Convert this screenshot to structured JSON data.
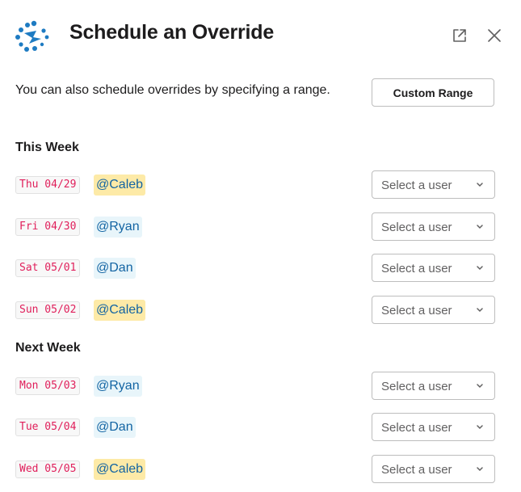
{
  "header": {
    "title": "Schedule an Override",
    "logo": "scheduler-app-logo",
    "external_link_icon": "external-link-icon",
    "close_icon": "close-icon"
  },
  "intro": {
    "text": "You can also schedule overrides by specifying a range.",
    "button_label": "Custom Range"
  },
  "sections": [
    {
      "title": "This Week",
      "rows": [
        {
          "date": "Thu 04/29",
          "user": "@Caleb",
          "highlight": "self",
          "select_placeholder": "Select a user"
        },
        {
          "date": "Fri 04/30",
          "user": "@Ryan",
          "highlight": "other",
          "select_placeholder": "Select a user"
        },
        {
          "date": "Sat 05/01",
          "user": "@Dan",
          "highlight": "other",
          "select_placeholder": "Select a user"
        },
        {
          "date": "Sun 05/02",
          "user": "@Caleb",
          "highlight": "self",
          "select_placeholder": "Select a user"
        }
      ]
    },
    {
      "title": "Next Week",
      "rows": [
        {
          "date": "Mon 05/03",
          "user": "@Ryan",
          "highlight": "other",
          "select_placeholder": "Select a user"
        },
        {
          "date": "Tue 05/04",
          "user": "@Dan",
          "highlight": "other",
          "select_placeholder": "Select a user"
        },
        {
          "date": "Wed 05/05",
          "user": "@Caleb",
          "highlight": "self",
          "select_placeholder": "Select a user"
        }
      ]
    }
  ],
  "colors": {
    "date_text": "#e01e5a",
    "mention_text": "#1264a3",
    "mention_self_bg": "#fdeaa7",
    "mention_other_bg": "#e8f5fa",
    "logo": "#1e7bc2"
  }
}
